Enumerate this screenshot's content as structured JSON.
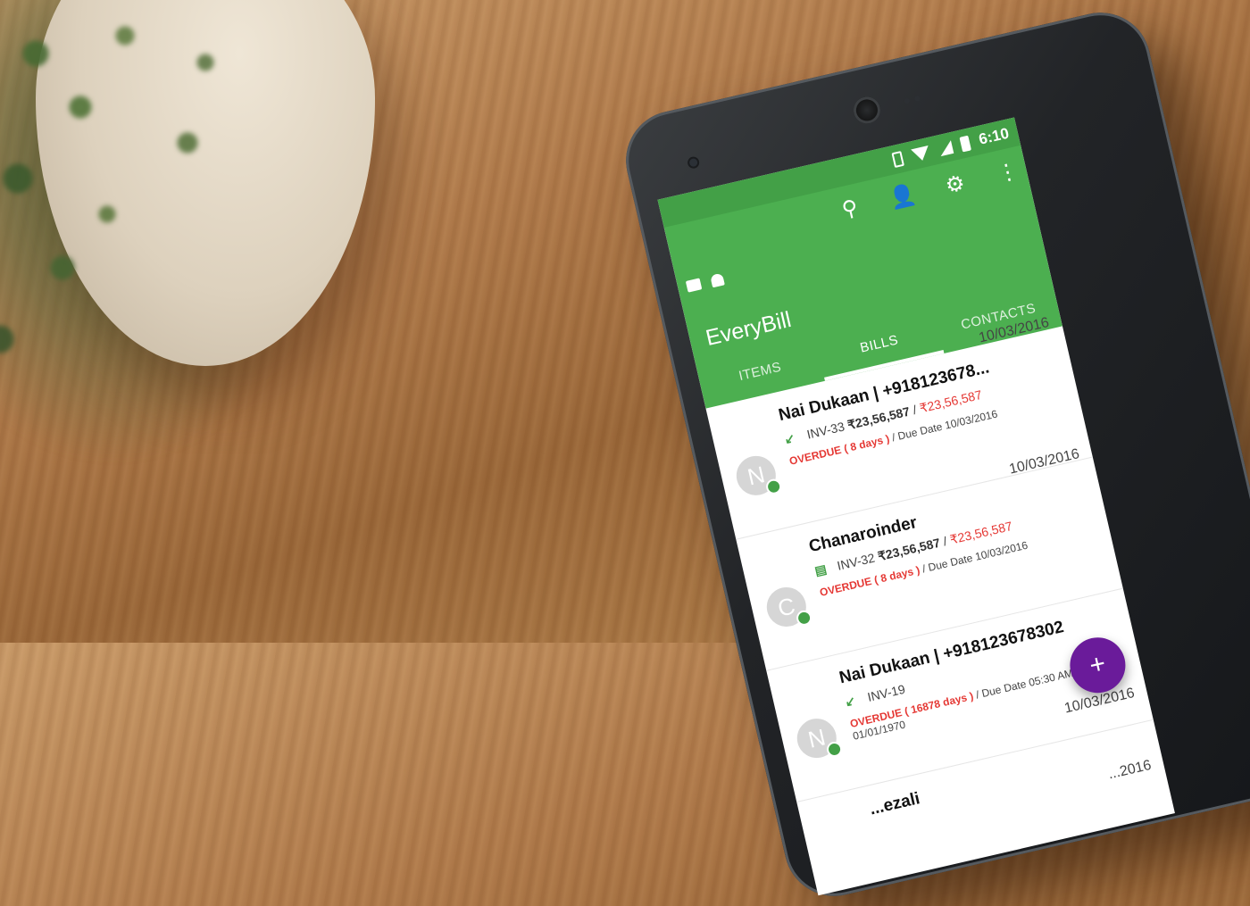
{
  "app": {
    "title": "EveryBill",
    "status_time": "6:10"
  },
  "toolbar": {
    "icons": [
      "search-icon",
      "person-icon",
      "gear-icon",
      "more-vert-icon"
    ]
  },
  "tabs": [
    {
      "label": "ITEMS",
      "active": false
    },
    {
      "label": "BILLS",
      "active": true
    },
    {
      "label": "CONTACTS",
      "active": false
    }
  ],
  "bills": [
    {
      "avatar": "N",
      "name": "Nai Dukaan | +918123678...",
      "date": "10/03/2016",
      "invoice": "INV-33",
      "amount": "₹23,56,587",
      "amount_due": "₹23,56,587",
      "due_text": "Due Date 10/03/2016",
      "overdue": "OVERDUE ( 8 days )",
      "status_icon": "received-arrow-icon"
    },
    {
      "avatar": "C",
      "name": "Chanaroinder",
      "date": "10/03/2016",
      "invoice": "INV-32",
      "amount": "₹23,56,587",
      "amount_due": "₹23,56,587",
      "due_text": "Due Date 10/03/2016",
      "overdue": "OVERDUE ( 8 days )",
      "status_icon": "document-icon"
    },
    {
      "avatar": "N",
      "name": "Nai Dukaan | +918123678302",
      "date": "10/03/2016",
      "invoice": "INV-19",
      "amount": "",
      "amount_due": "",
      "due_text": "Due Date 05:30 AM, 01/01/1970",
      "overdue": "OVERDUE ( 16878 days )",
      "status_icon": "received-arrow-icon"
    },
    {
      "avatar": "",
      "name": "...ezali",
      "date": "...2016",
      "invoice": "",
      "amount": "",
      "amount_due": "",
      "due_text": "",
      "overdue": "",
      "status_icon": ""
    }
  ],
  "fab": {
    "icon": "add-icon"
  }
}
